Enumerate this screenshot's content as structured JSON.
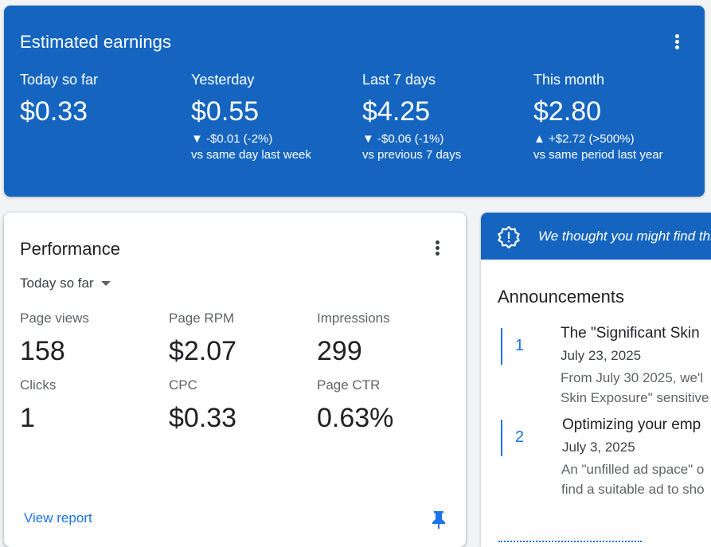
{
  "earnings": {
    "title": "Estimated earnings",
    "metrics": [
      {
        "label": "Today so far",
        "value": "$0.33",
        "delta": "",
        "compare": ""
      },
      {
        "label": "Yesterday",
        "value": "$0.55",
        "delta": "▼ -$0.01 (-2%)",
        "compare": "vs same day last week"
      },
      {
        "label": "Last 7 days",
        "value": "$4.25",
        "delta": "▼ -$0.06 (-1%)",
        "compare": "vs previous 7 days"
      },
      {
        "label": "This month",
        "value": "$2.80",
        "delta": "▲ +$2.72 (>500%)",
        "compare": "vs same period last year"
      }
    ]
  },
  "performance": {
    "title": "Performance",
    "range": "Today so far",
    "stats": [
      {
        "label": "Page views",
        "value": "158"
      },
      {
        "label": "Page RPM",
        "value": "$2.07"
      },
      {
        "label": "Impressions",
        "value": "299"
      },
      {
        "label": "Clicks",
        "value": "1"
      },
      {
        "label": "CPC",
        "value": "$0.33"
      },
      {
        "label": "Page CTR",
        "value": "0.63%"
      }
    ],
    "view_report": "View report"
  },
  "announcements": {
    "banner": "We thought you might find this useful",
    "title": "Announcements",
    "items": [
      {
        "num": "1",
        "heading": "The \"Significant Skin",
        "date": "July 23, 2025",
        "body1": "From July 30 2025, we'l",
        "body2": "Skin Exposure\" sensitive"
      },
      {
        "num": "2",
        "heading": "Optimizing your emp",
        "date": "July 3, 2025",
        "body1": "An \"unfilled ad space\" o",
        "body2": "find a suitable ad to sho"
      }
    ]
  },
  "colors": {
    "primary": "#1565c0",
    "link": "#1a73e8"
  },
  "icons": {
    "menu": "more-vert-icon",
    "caret": "arrow-drop-down-icon",
    "pin": "push-pin-icon",
    "alert": "new-releases-icon"
  }
}
